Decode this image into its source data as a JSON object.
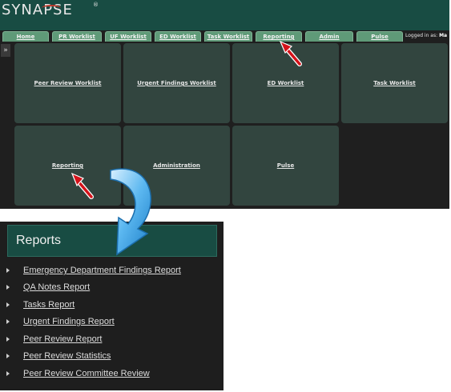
{
  "app": {
    "logo": "SYNAPSE",
    "logo_mark": "®",
    "nav_tabs": [
      "Home",
      "PR Worklist",
      "UF Worklist",
      "ED Worklist",
      "Task Worklist",
      "Reporting",
      "Admin",
      "Pulse"
    ],
    "logged_in_label": "Logged in as:",
    "logged_in_user": "Ma",
    "sidebar_toggle": "»",
    "tiles": [
      "Peer Review Worklist",
      "Urgent Findings Worklist",
      "ED Worklist",
      "Task Worklist",
      "Reporting",
      "Administration",
      "Pulse"
    ]
  },
  "reports": {
    "title": "Reports",
    "items": [
      "Emergency Department Findings Report",
      "QA Notes Report",
      "Tasks Report",
      "Urgent Findings Report",
      "Peer Review Report",
      "Peer Review Statistics",
      "Peer Review Committee Review"
    ]
  },
  "colors": {
    "header_green": "#184c43",
    "tab_green": "#5f9a78",
    "tile_bg": "#32453f",
    "arrow_red": "#d4121a",
    "callout_blue": "#2f9be0"
  }
}
